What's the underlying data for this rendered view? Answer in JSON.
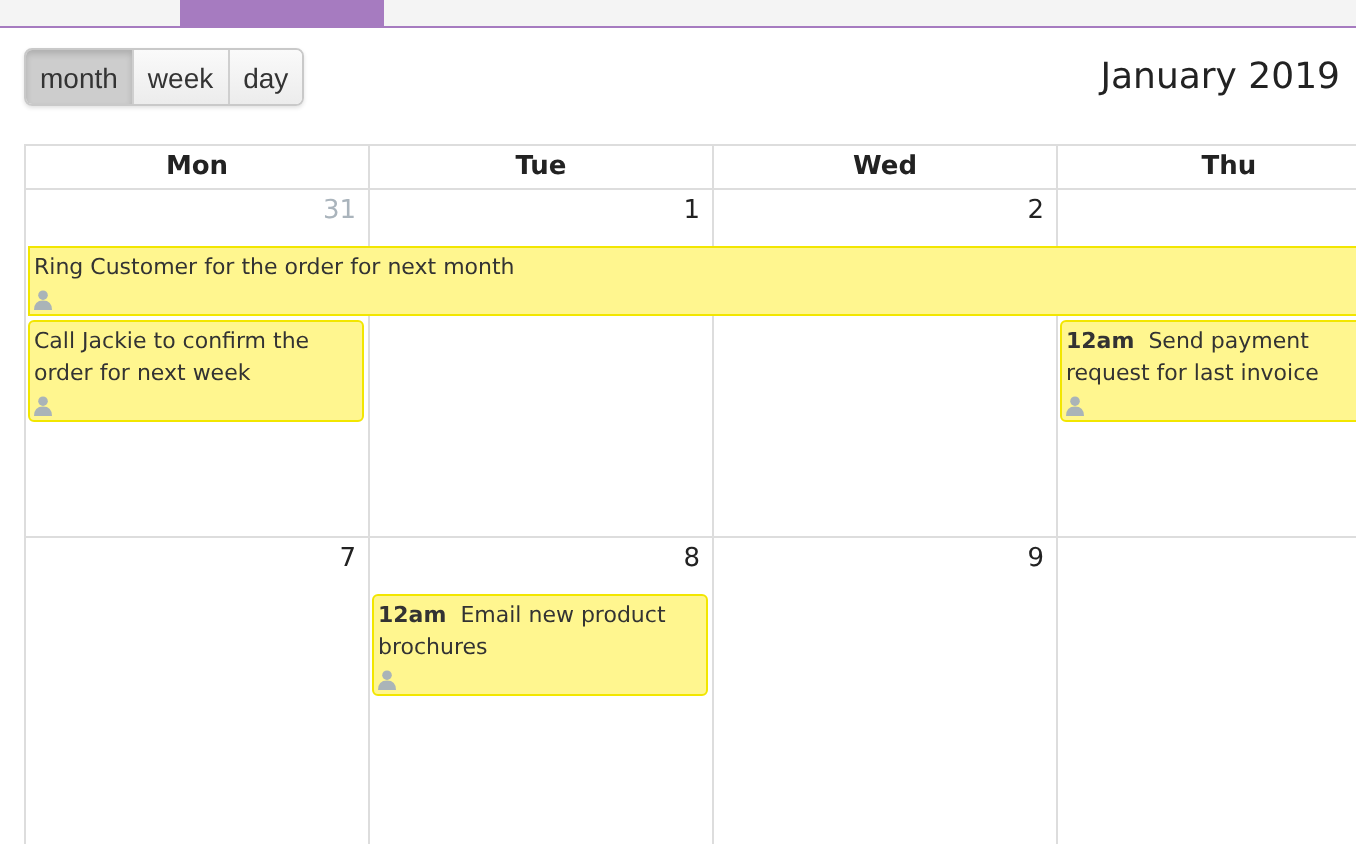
{
  "views": [
    {
      "label": "month",
      "selected": true
    },
    {
      "label": "week",
      "selected": false
    },
    {
      "label": "day",
      "selected": false
    }
  ],
  "title": "January 2019",
  "weekdays": [
    "Mon",
    "Tue",
    "Wed",
    "Thu"
  ],
  "weeks": [
    {
      "days": [
        {
          "number": "31",
          "other_month": true,
          "events": [
            {
              "kind": "spans_to_edge",
              "title": "Ring Customer for the order for next month"
            },
            {
              "kind": "single",
              "title": "Call Jackie to confirm the order for next week"
            }
          ]
        },
        {
          "number": "1",
          "other_month": false
        },
        {
          "number": "2",
          "other_month": false
        },
        {
          "events": [
            {
              "kind": "single",
              "time": "12am",
              "title": "Send payment request for last invoice"
            }
          ]
        }
      ]
    },
    {
      "days": [
        {
          "number": "7",
          "other_month": false
        },
        {
          "number": "8",
          "other_month": false,
          "events": [
            {
              "kind": "single",
              "time": "12am",
              "title": "Email new product brochures"
            }
          ]
        },
        {
          "number": "9",
          "other_month": false
        }
      ]
    }
  ]
}
